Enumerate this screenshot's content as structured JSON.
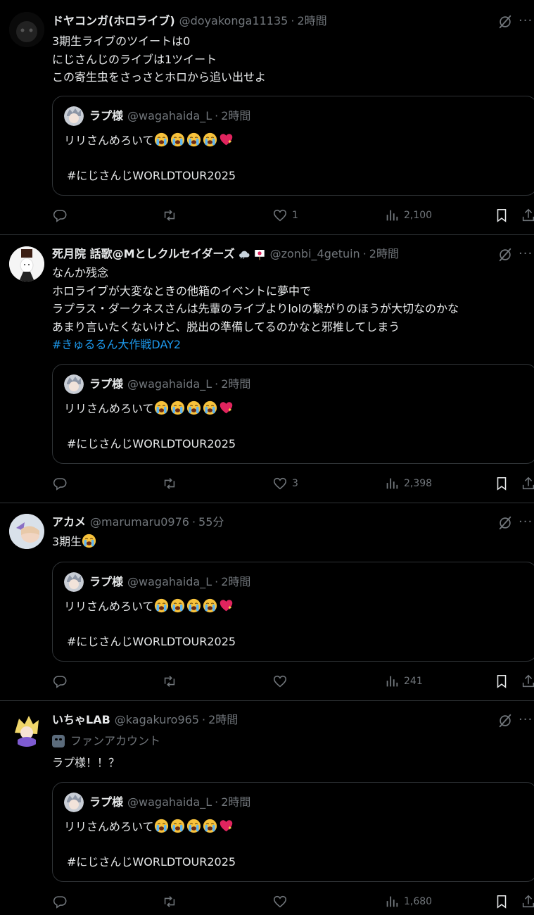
{
  "tweets": [
    {
      "name": "ドヤコンガ(ホロライブ)",
      "handle": "@doyakonga11135",
      "time": "2時間",
      "lines": [
        "3期生ライブのツイートは0",
        "にじさんじのライブは1ツイート",
        "この寄生虫をさっさとホロから追い出せよ"
      ],
      "hashtag": "",
      "likes": "1",
      "views": "2,100"
    },
    {
      "name": "死月院 話歌@Mとしクルセイダーズ",
      "handle": "@zonbi_4getuin",
      "time": "2時間",
      "lines": [
        "なんか残念",
        "ホロライブが大変なときの他箱のイベントに夢中で",
        "ラプラス・ダークネスさんは先輩のライブよりlolの繋がりのほうが大切なのかな",
        "あまり言いたくないけど、脱出の準備してるのかなと邪推してしまう"
      ],
      "hashtag": "#きゅるるん大作戦DAY2",
      "likes": "3",
      "views": "2,398"
    },
    {
      "name": "アカメ",
      "handle": "@marumaru0976",
      "time": "55分",
      "lines": [
        "3期生"
      ],
      "hashtag": "",
      "likes": "",
      "views": "241"
    },
    {
      "name": "いちゃLAB",
      "handle": "@kagakuro965",
      "time": "2時間",
      "fan_label": "ファンアカウント",
      "lines": [
        "ラプ様！！？"
      ],
      "hashtag": "",
      "likes": "",
      "views": "1,680"
    }
  ],
  "quote": {
    "name": "ラプ様",
    "handle": "@wagahaida_L",
    "time": "2時間",
    "text": "リリさんめろいて",
    "hashtag": "#にじさんじWORLDTOUR2025"
  },
  "separator": "·",
  "more_label": "···",
  "icons": [
    "grok-icon",
    "reply-icon",
    "retweet-icon",
    "like-icon",
    "views-icon",
    "bookmark-icon",
    "share-icon",
    "crying-emoji",
    "sparkling-heart-emoji"
  ],
  "colors": {
    "background": "#000000",
    "text": "#e7e9ea",
    "muted": "#71767b",
    "link": "#1d9bf0",
    "border": "#2f3336"
  }
}
